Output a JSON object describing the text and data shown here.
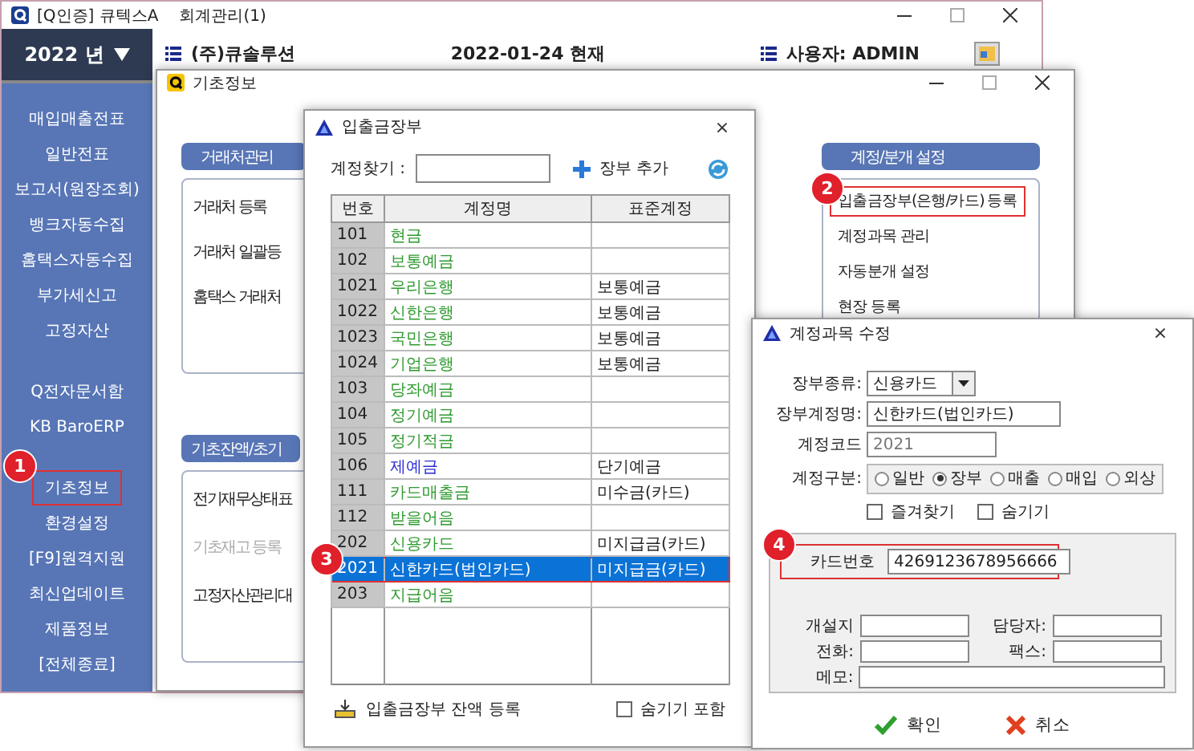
{
  "main_window": {
    "title": "[Q인증] 큐텍스A",
    "subtitle": "회계관리(1)",
    "year": "2022 년",
    "company": "(주)큐솔루션",
    "date": "2022-01-24 현재",
    "user": "사용자: ADMIN"
  },
  "sidebar": {
    "items": [
      {
        "label": "매입매출전표",
        "highlighted": false
      },
      {
        "label": "일반전표",
        "highlighted": false
      },
      {
        "label": "보고서(원장조회)",
        "highlighted": false
      },
      {
        "label": "뱅크자동수집",
        "highlighted": false
      },
      {
        "label": "홈택스자동수집",
        "highlighted": false
      },
      {
        "label": "부가세신고",
        "highlighted": false
      },
      {
        "label": "고정자산",
        "highlighted": false
      },
      {
        "label": "Q전자문서함",
        "highlighted": false
      },
      {
        "label": "KB BaroERP",
        "highlighted": false
      },
      {
        "label": "기초정보",
        "highlighted": true,
        "badge": "1"
      },
      {
        "label": "환경설정",
        "highlighted": false
      },
      {
        "label": "[F9]원격지원",
        "highlighted": false
      },
      {
        "label": "최신업데이트",
        "highlighted": false
      },
      {
        "label": "제품정보",
        "highlighted": false
      },
      {
        "label": "[전체종료]",
        "highlighted": false
      }
    ]
  },
  "basic_info_window": {
    "title": "기초정보",
    "left_groups": [
      {
        "title": "거래처관리",
        "items": [
          {
            "label": "거래처 등록",
            "disabled": false
          },
          {
            "label": "거래처 일괄등",
            "disabled": false
          },
          {
            "label": "홈택스 거래처",
            "disabled": false
          }
        ]
      },
      {
        "title": "기초잔액/초기",
        "items": [
          {
            "label": "전기재무상태표",
            "disabled": false
          },
          {
            "label": "기초재고 등록",
            "disabled": true
          },
          {
            "label": "고정자산관리대",
            "disabled": false
          }
        ]
      }
    ],
    "right_group": {
      "title": "계정/분개 설정",
      "items": [
        {
          "label": "입출금장부(은행/카드) 등록",
          "highlighted": true,
          "badge": "2"
        },
        {
          "label": "계정과목 관리",
          "highlighted": false
        },
        {
          "label": "자동분개 설정",
          "highlighted": false
        },
        {
          "label": "현장 등록",
          "highlighted": false
        }
      ]
    }
  },
  "ledger_dialog": {
    "title": "입출금장부",
    "close": "×",
    "search_label": "계정찾기 :",
    "add_button": "장부 추가",
    "columns": [
      "번호",
      "계정명",
      "표준계정"
    ],
    "rows": [
      {
        "code": "101",
        "name": "현금",
        "standard": "",
        "color": "#2e9a2e",
        "selected": false
      },
      {
        "code": "102",
        "name": "보통예금",
        "standard": "",
        "color": "#2e9a2e",
        "selected": false
      },
      {
        "code": "1021",
        "name": "우리은행",
        "standard": "보통예금",
        "color": "#2e9a2e",
        "selected": false
      },
      {
        "code": "1022",
        "name": "신한은행",
        "standard": "보통예금",
        "color": "#2e9a2e",
        "selected": false
      },
      {
        "code": "1023",
        "name": "국민은행",
        "standard": "보통예금",
        "color": "#2e9a2e",
        "selected": false
      },
      {
        "code": "1024",
        "name": "기업은행",
        "standard": "보통예금",
        "color": "#2e9a2e",
        "selected": false
      },
      {
        "code": "103",
        "name": "당좌예금",
        "standard": "",
        "color": "#2e9a2e",
        "selected": false
      },
      {
        "code": "104",
        "name": "정기예금",
        "standard": "",
        "color": "#2e9a2e",
        "selected": false
      },
      {
        "code": "105",
        "name": "정기적금",
        "standard": "",
        "color": "#2e9a2e",
        "selected": false
      },
      {
        "code": "106",
        "name": "제예금",
        "standard": "단기예금",
        "color": "#2b2bd8",
        "selected": false
      },
      {
        "code": "111",
        "name": "카드매출금",
        "standard": "미수금(카드)",
        "color": "#2e9a2e",
        "selected": false
      },
      {
        "code": "112",
        "name": "받을어음",
        "standard": "",
        "color": "#2e9a2e",
        "selected": false
      },
      {
        "code": "202",
        "name": "신용카드",
        "standard": "미지급금(카드)",
        "color": "#2e9a2e",
        "selected": false
      },
      {
        "code": "2021",
        "name": "신한카드(법인카드)",
        "standard": "미지급금(카드)",
        "selected": true,
        "badge": "3"
      },
      {
        "code": "203",
        "name": "지급어음",
        "standard": "",
        "color": "#2e9a2e",
        "selected": false
      }
    ],
    "balance_button": "입출금장부 잔액 등록",
    "include_hidden": {
      "label": "숨기기 포함",
      "checked": false
    }
  },
  "account_dialog": {
    "title": "계정과목 수정",
    "close": "×",
    "ledger_type": {
      "label": "장부종류:",
      "value": "신용카드"
    },
    "ledger_name": {
      "label": "장부계정명:",
      "value": "신한카드(법인카드)"
    },
    "account_code": {
      "label": "계정코드",
      "value": "2021",
      "disabled": true
    },
    "category": {
      "label": "계정구분:",
      "options": [
        {
          "label": "일반",
          "selected": false
        },
        {
          "label": "장부",
          "selected": true
        },
        {
          "label": "매출",
          "selected": false
        },
        {
          "label": "매입",
          "selected": false
        },
        {
          "label": "외상",
          "selected": false
        }
      ]
    },
    "checkboxes": [
      {
        "label": "즐겨찾기",
        "checked": false
      },
      {
        "label": "숨기기",
        "checked": false
      }
    ],
    "card_number": {
      "label": "카드번호",
      "value": "4269123678956666",
      "badge": "4"
    },
    "fields": [
      {
        "label": "개설지"
      },
      {
        "label": "담당자:"
      },
      {
        "label": "전화:"
      },
      {
        "label": "팩스:"
      },
      {
        "label": "메모:"
      }
    ],
    "buttons": [
      {
        "kind": "ok",
        "label": "확인"
      },
      {
        "kind": "cancel",
        "label": "취소"
      }
    ]
  }
}
